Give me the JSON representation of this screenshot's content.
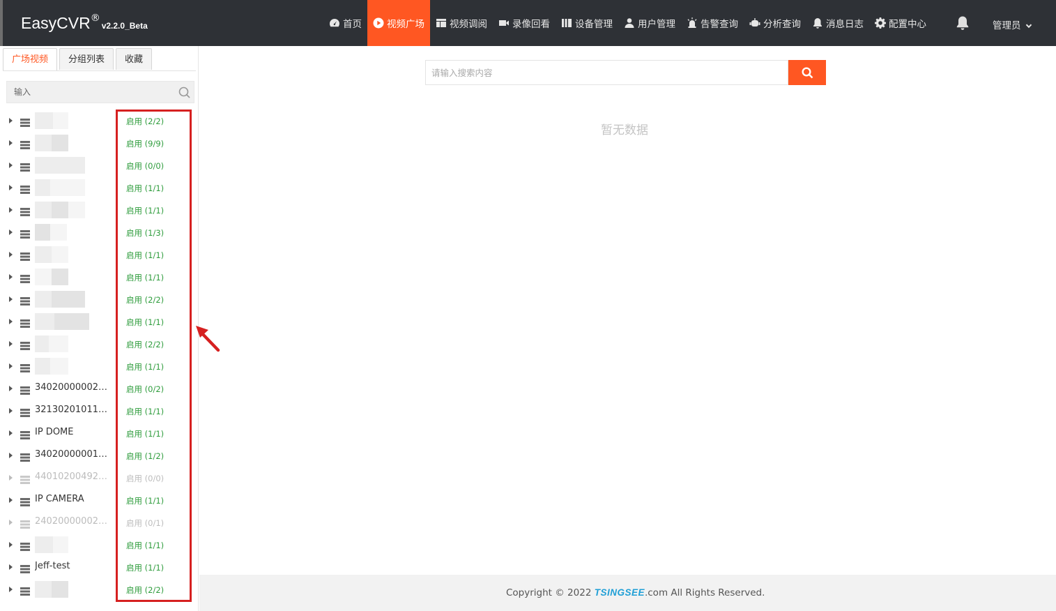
{
  "header": {
    "brand_name": "EasyCVR",
    "brand_reg": "®",
    "brand_version": "v2.2.0_Beta",
    "nav": [
      {
        "label": "首页",
        "icon": "dashboard-icon"
      },
      {
        "label": "视频广场",
        "icon": "play-circle-icon",
        "active": true
      },
      {
        "label": "视频调阅",
        "icon": "layout-icon"
      },
      {
        "label": "录像回看",
        "icon": "video-camera-icon"
      },
      {
        "label": "设备管理",
        "icon": "devices-icon"
      },
      {
        "label": "用户管理",
        "icon": "user-icon"
      },
      {
        "label": "告警查询",
        "icon": "alarm-icon"
      },
      {
        "label": "分析查询",
        "icon": "robot-icon"
      },
      {
        "label": "消息日志",
        "icon": "bell-icon"
      },
      {
        "label": "配置中心",
        "icon": "gear-icon"
      }
    ],
    "user": "管理员"
  },
  "sidebar": {
    "tabs": [
      "广场视频",
      "分组列表",
      "收藏"
    ],
    "search_placeholder": "输入",
    "devices": [
      {
        "name": "",
        "status": "启用 (2/2)",
        "blurred": true
      },
      {
        "name": "",
        "status": "启用 (9/9)",
        "blurred": true
      },
      {
        "name": "",
        "status": "启用 (0/0)",
        "blurred": true
      },
      {
        "name": "",
        "status": "启用 (1/1)",
        "blurred": true
      },
      {
        "name": "",
        "status": "启用 (1/1)",
        "blurred": true
      },
      {
        "name": "",
        "status": "启用 (1/3)",
        "blurred": true
      },
      {
        "name": "",
        "status": "启用 (1/1)",
        "blurred": true
      },
      {
        "name": "",
        "status": "启用 (1/1)",
        "blurred": true
      },
      {
        "name": "",
        "status": "启用 (2/2)",
        "blurred": true
      },
      {
        "name": "",
        "status": "启用 (1/1)",
        "blurred": true
      },
      {
        "name": "",
        "status": "启用 (2/2)",
        "blurred": true
      },
      {
        "name": "",
        "status": "启用 (1/1)",
        "blurred": true
      },
      {
        "name": "3402000000200...",
        "status": "启用 (0/2)"
      },
      {
        "name": "3213020101131...",
        "status": "启用 (1/1)"
      },
      {
        "name": "IP DOME",
        "status": "启用 (1/1)"
      },
      {
        "name": "3402000000132...",
        "status": "启用 (1/2)"
      },
      {
        "name": "4401020049200...",
        "status": "启用 (0/0)",
        "offline": true
      },
      {
        "name": "IP CAMERA",
        "status": "启用 (1/1)"
      },
      {
        "name": "2402000000200...",
        "status": "启用 (0/1)",
        "offline": true
      },
      {
        "name": "",
        "status": "启用 (1/1)",
        "blurred": true
      },
      {
        "name": "Jeff-test",
        "status": "启用 (1/1)"
      },
      {
        "name": "",
        "status": "启用 (2/2)",
        "blurred": true
      }
    ]
  },
  "main": {
    "search_placeholder": "请输入搜索内容",
    "empty_text": "暂无数据"
  },
  "footer": {
    "prefix": "Copyright © 2022 ",
    "logo": "TSINGSEE",
    "suffix": ".com All Rights Reserved."
  },
  "colors": {
    "accent": "#ff5722",
    "topbar": "#2e3136",
    "status_green": "#2e9c3c",
    "annotation_red": "#d62020"
  }
}
